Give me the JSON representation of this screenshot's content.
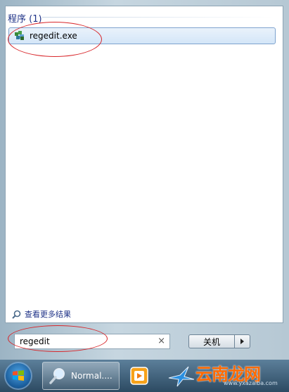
{
  "start_menu": {
    "group_header": "程序 (1)",
    "results": [
      {
        "label": "regedit.exe",
        "icon": "registry-editor-icon"
      }
    ],
    "see_more_label": "查看更多结果",
    "search": {
      "value": "regedit",
      "clear_glyph": "×"
    },
    "shutdown_label": "关机"
  },
  "taskbar": {
    "items": [
      {
        "label": "Normal....",
        "icon": "magnifier-icon"
      }
    ]
  },
  "watermark": {
    "brand": "云南龙网",
    "url": "www.yxazaiba.com"
  },
  "colors": {
    "highlight_oval": "#d8262a",
    "group_header": "#1e3287",
    "watermark": "#ff6a00"
  }
}
